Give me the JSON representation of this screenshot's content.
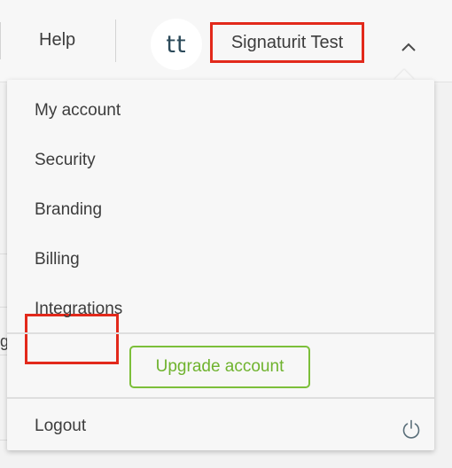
{
  "header": {
    "help_label": "Help",
    "avatar_initials": "tt",
    "user_name": "Signaturit Test",
    "toggle_icon": "chevron-up-icon"
  },
  "menu": {
    "items": [
      {
        "label": "My account"
      },
      {
        "label": "Security"
      },
      {
        "label": "Branding"
      },
      {
        "label": "Billing"
      },
      {
        "label": "Integrations"
      }
    ],
    "upgrade_label": "Upgrade account",
    "logout_label": "Logout",
    "logout_icon": "power-icon"
  },
  "background": {
    "partial_text": "g"
  },
  "colors": {
    "highlight": "#e2291b",
    "upgrade_green": "#7cbf3a",
    "avatar_text": "#2c4a5a"
  }
}
